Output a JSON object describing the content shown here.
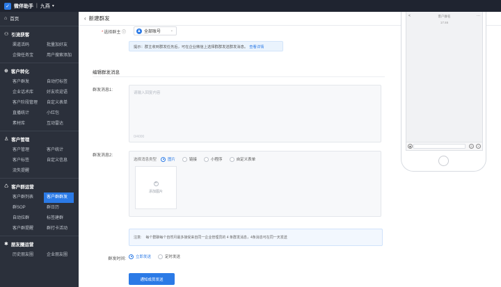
{
  "topbar": {
    "app_name": "微伴助手",
    "separator": "|",
    "corp_name": "九燕",
    "logo_icon": "check"
  },
  "sidebar": {
    "home": "首页",
    "groups": [
      {
        "title": "引流获客",
        "items": [
          "渠道活码",
          "批量加好友",
          "企微任务宝",
          "用户搜索添加"
        ]
      },
      {
        "title": "客户转化",
        "items": [
          "客户群发",
          "自动打标签",
          "企业话术库",
          "好友欢迎语",
          "客户阶段管理",
          "自定义表单",
          "直播统计",
          "小红包",
          "素材库",
          "互动雷达"
        ]
      },
      {
        "title": "客户管理",
        "items": [
          "客户管理",
          "客户统计",
          "客户标签",
          "自定义信息",
          "流失提醒"
        ]
      },
      {
        "title": "客户群运营",
        "items": [
          "客户群列表",
          "客户群群发",
          "群SOP",
          "群日历",
          "自动拉群",
          "标签建群",
          "客户群提醒",
          "群打卡活动"
        ]
      },
      {
        "title": "朋友圈运营",
        "items": [
          "历史朋友圈",
          "企业朋友圈"
        ]
      },
      {
        "title": "",
        "items": []
      }
    ],
    "active_item": "客户群群发"
  },
  "page": {
    "title": "新建群发"
  },
  "form": {
    "select_group_owner_label": "选择群主",
    "select_value": "全部账号",
    "tip_text": "提示：群主收到群发任务后，可在企业微信上选择群群发送群发消息。",
    "tip_link": "查看详情",
    "section_title": "编辑群发消息",
    "msg1_label": "群发消息1:",
    "msg1_placeholder": "请输入回复内容",
    "msg1_counter": "0/4000",
    "msg2_label": "群发消息2:",
    "msg2_type_label": "选择消息类型",
    "msg2_types": [
      "图片",
      "链接",
      "小程序",
      "自定义表单"
    ],
    "msg2_selected": "图片",
    "upload_label": "添加图片",
    "notice_label": "注意:",
    "notice_text": "每个群聊每个自然月最多接受来自同一企业管理员的 4 条群发消息，4条消息可在同一天发送",
    "time_label": "群发时间:",
    "time_options": [
      "立即发送",
      "定时发送"
    ],
    "time_selected": "立即发送",
    "submit_label": "通知成员发送"
  },
  "phone": {
    "title": "客户群名",
    "time": "17:46",
    "back_glyph": "<",
    "more_glyph": "···"
  },
  "colors": {
    "primary": "#2b7ae6",
    "sidebar_bg": "#2b303b",
    "topbar_bg": "#1f2430"
  }
}
